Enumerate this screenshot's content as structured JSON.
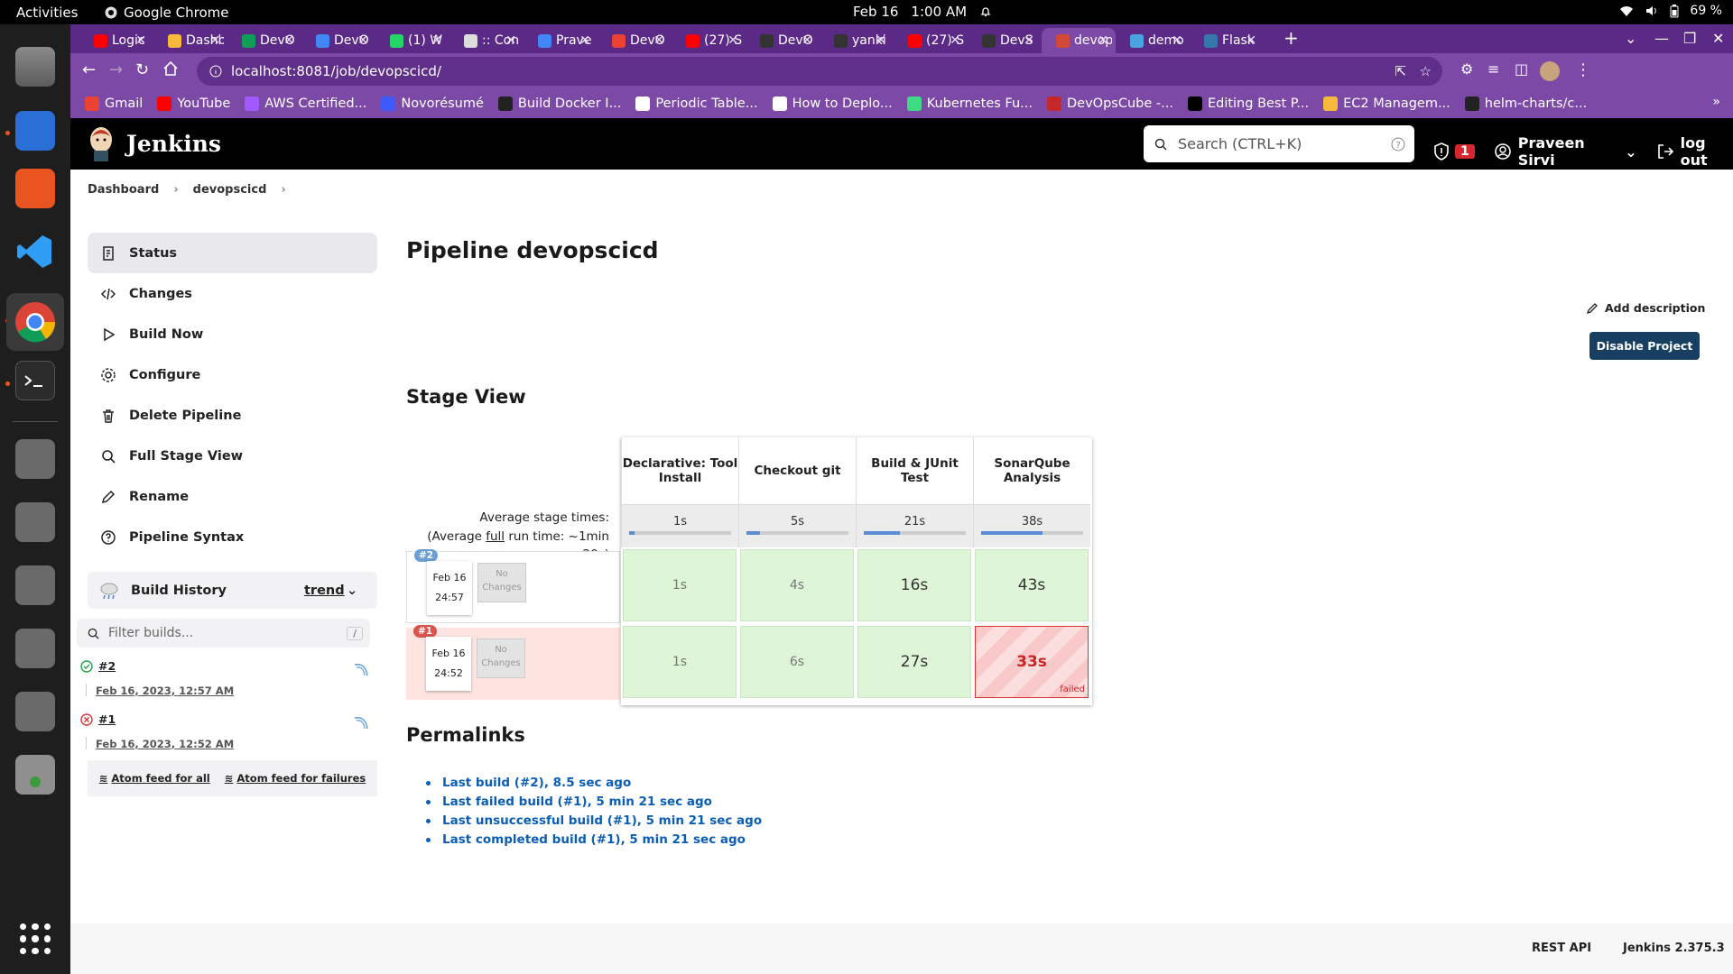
{
  "os": {
    "activities": "Activities",
    "app_name": "Google Chrome",
    "date": "Feb 16",
    "time": "1:00 AM",
    "battery": "69 %"
  },
  "browser": {
    "tabs": [
      {
        "title": "Logic",
        "color": "#ff0000"
      },
      {
        "title": "Dashb",
        "color": "#f6b93b"
      },
      {
        "title": "DevO",
        "color": "#0f9d58"
      },
      {
        "title": "DevO",
        "color": "#4285f4"
      },
      {
        "title": "(1) W",
        "color": "#25d366"
      },
      {
        "title": ":: Con",
        "color": "#dddddd"
      },
      {
        "title": "Prave",
        "color": "#4285f4"
      },
      {
        "title": "DevO",
        "color": "#ea4335"
      },
      {
        "title": "(27) S",
        "color": "#ff0000"
      },
      {
        "title": "DevO",
        "color": "#333333"
      },
      {
        "title": "yanki",
        "color": "#333333"
      },
      {
        "title": "(27) S",
        "color": "#ff0000"
      },
      {
        "title": "DevS",
        "color": "#333333"
      },
      {
        "title": "devop",
        "color": "#d24939"
      },
      {
        "title": "demo",
        "color": "#4aa3df"
      },
      {
        "title": "Flask",
        "color": "#3776ab"
      }
    ],
    "new_tab": "+",
    "url": "localhost:8081/job/devopscicd/",
    "bookmarks": [
      {
        "label": "Gmail",
        "color": "#ea4335"
      },
      {
        "label": "YouTube",
        "color": "#ff0000"
      },
      {
        "label": "AWS Certified...",
        "color": "#a259ff"
      },
      {
        "label": "Novorésumé",
        "color": "#3d5afe"
      },
      {
        "label": "Build Docker I...",
        "color": "#222222"
      },
      {
        "label": "Periodic Table...",
        "color": "#ffffff"
      },
      {
        "label": "How to Deplo...",
        "color": "#ffffff"
      },
      {
        "label": "Kubernetes Fu...",
        "color": "#3ddc84"
      },
      {
        "label": "DevOpsCube -...",
        "color": "#c62828"
      },
      {
        "label": "Editing Best P...",
        "color": "#000000"
      },
      {
        "label": "EC2 Managem...",
        "color": "#f6b93b"
      },
      {
        "label": "helm-charts/c...",
        "color": "#222222"
      }
    ]
  },
  "jenkins": {
    "brand": "Jenkins",
    "search_placeholder": "Search (CTRL+K)",
    "security_count": "1",
    "user": "Praveen Sirvi",
    "logout": "log out",
    "breadcrumb": [
      "Dashboard",
      "devopscicd"
    ],
    "sidebar": [
      {
        "label": "Status",
        "icon": "status-icon"
      },
      {
        "label": "Changes",
        "icon": "code-icon"
      },
      {
        "label": "Build Now",
        "icon": "play-icon"
      },
      {
        "label": "Configure",
        "icon": "gear-icon"
      },
      {
        "label": "Delete Pipeline",
        "icon": "trash-icon"
      },
      {
        "label": "Full Stage View",
        "icon": "search-icon"
      },
      {
        "label": "Rename",
        "icon": "pencil-icon"
      },
      {
        "label": "Pipeline Syntax",
        "icon": "help-icon"
      }
    ],
    "build_history": {
      "title": "Build History",
      "trend": "trend",
      "filter_placeholder": "Filter builds...",
      "filter_shortcut": "/",
      "builds": [
        {
          "id": "#2",
          "date": "Feb 16, 2023, 12:57 AM",
          "status": "success"
        },
        {
          "id": "#1",
          "date": "Feb 16, 2023, 12:52 AM",
          "status": "failed"
        }
      ],
      "feed_all": "Atom feed for all",
      "feed_failures": "Atom feed for failures"
    },
    "page_title": "Pipeline devopscicd",
    "add_description": "Add description",
    "disable_project": "Disable Project",
    "stage_view": {
      "title": "Stage View",
      "avg_line1": "Average stage times:",
      "avg_line2_pre": "(Average ",
      "avg_line2_link": "full",
      "avg_line2_post": " run time: ~1min",
      "avg_line3": "20s)",
      "stages": [
        {
          "name": "Declarative: Tool Install",
          "avg": "1s",
          "avg_fraction": 0.05
        },
        {
          "name": "Checkout git",
          "avg": "5s",
          "avg_fraction": 0.13
        },
        {
          "name": "Build & JUnit Test",
          "avg": "21s",
          "avg_fraction": 0.35
        },
        {
          "name": "SonarQube Analysis",
          "avg": "38s",
          "avg_fraction": 0.6
        }
      ],
      "runs": [
        {
          "badge": "#2",
          "month": "Feb 16",
          "time": "24:57",
          "changes": "No Changes",
          "status": "success",
          "badge_color": "#6a9fd4",
          "cells": [
            "1s",
            "4s",
            "16s",
            "43s"
          ]
        },
        {
          "badge": "#1",
          "month": "Feb 16",
          "time": "24:52",
          "changes": "No Changes",
          "status": "failed",
          "badge_color": "#d9534f",
          "cells": [
            "1s",
            "6s",
            "27s",
            "33s"
          ],
          "failed_label": "failed"
        }
      ]
    },
    "permalinks": {
      "title": "Permalinks",
      "items": [
        "Last build (#2), 8.5 sec ago",
        "Last failed build (#1), 5 min 21 sec ago",
        "Last unsuccessful build (#1), 5 min 21 sec ago",
        "Last completed build (#1), 5 min 21 sec ago"
      ]
    },
    "footer": {
      "rest_api": "REST API",
      "version": "Jenkins 2.375.3"
    }
  }
}
